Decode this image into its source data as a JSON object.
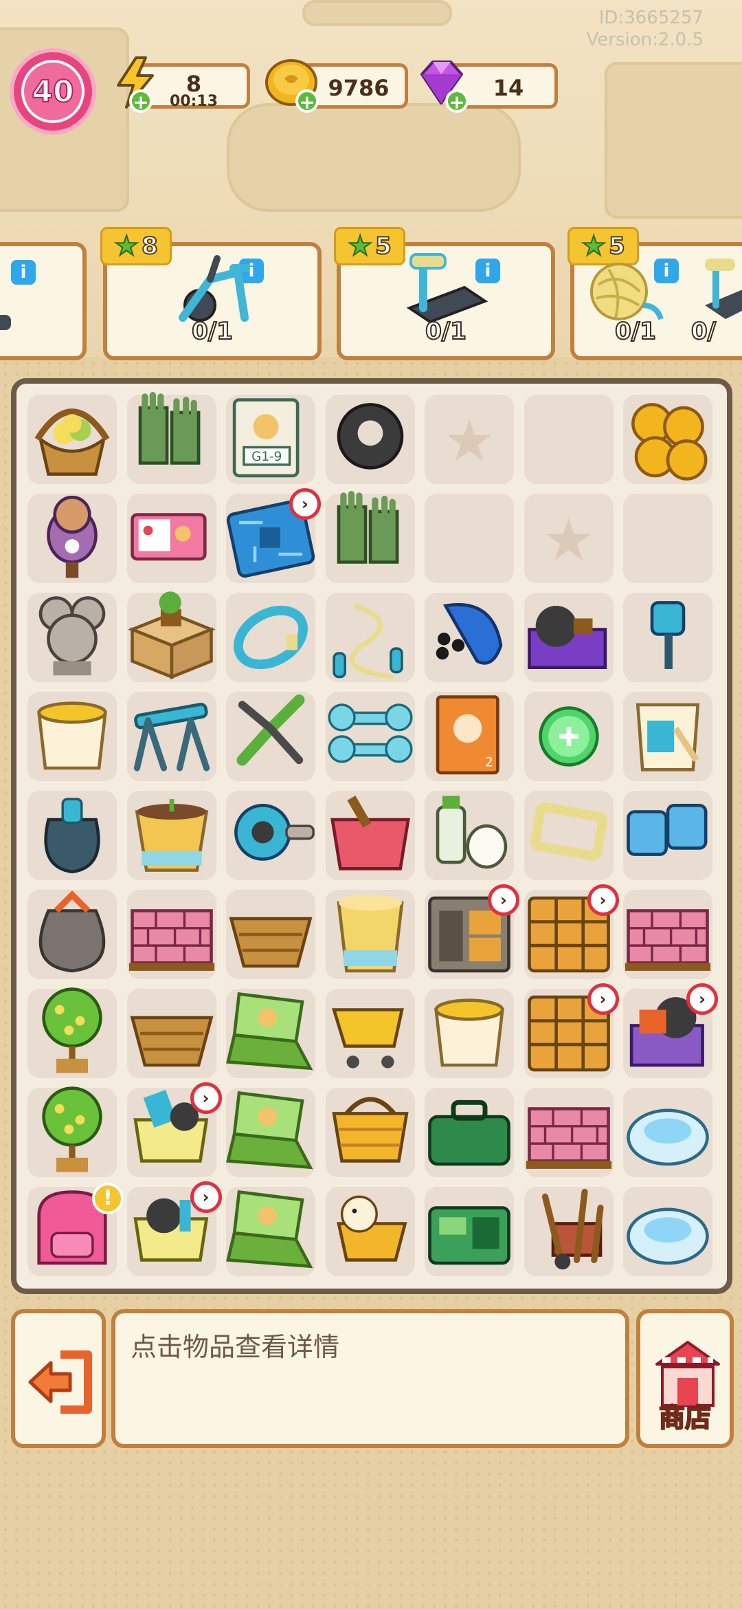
{
  "meta": {
    "id_text": "ID:3665257",
    "version_text": "Version:2.0.5"
  },
  "player": {
    "level": "40"
  },
  "resources": {
    "energy": {
      "value": "8",
      "timer": "00:13"
    },
    "coins": {
      "value": "9786"
    },
    "gems": {
      "value": "14"
    }
  },
  "orders": [
    {
      "stars": "",
      "progress": ""
    },
    {
      "stars": "8",
      "progress": "0/1",
      "item": "exercise-bike"
    },
    {
      "stars": "5",
      "progress": "0/1",
      "item": "treadmill"
    },
    {
      "stars": "5",
      "progress": "0/1",
      "item": "yarn-ball"
    },
    {
      "stars": "",
      "progress": "0/"
    }
  ],
  "inventory": {
    "rows": [
      [
        "flower-basket",
        "green-gloves",
        "book-g1-9",
        "tire",
        "locked-star",
        "empty",
        "gold-coins"
      ],
      [
        "dog-figurine",
        "bento-box",
        "circuit-board",
        "green-gloves",
        "empty",
        "locked-star",
        "empty"
      ],
      [
        "mouse-statue",
        "potted-plant-box",
        "hula-hoop",
        "jump-rope",
        "hair-dryer",
        "purple-crate",
        "paint-roller"
      ],
      [
        "yellow-bucket",
        "pull-up-bar",
        "garden-shears",
        "dumbbells",
        "orange-book",
        "green-button",
        "paint-bucket"
      ],
      [
        "punching-bag",
        "plant-pot",
        "ab-roller",
        "red-pot",
        "cleaning-bottle",
        "yellow-frame",
        "blue-dice"
      ],
      [
        "grey-sack",
        "pink-bricks",
        "wicker-basket",
        "paper-cup",
        "grey-cabinet",
        "yellow-cabinet",
        "pink-bricks"
      ],
      [
        "flower-tree",
        "wicker-basket",
        "green-laptop",
        "shopping-cart",
        "yellow-bucket",
        "yellow-cabinet",
        "junk-pile"
      ],
      [
        "flower-tree",
        "gym-cart",
        "green-laptop",
        "yellow-basket",
        "tackle-box",
        "pink-bricks",
        "robot-vacuum"
      ],
      [
        "pink-backpack",
        "fitness-cart",
        "green-laptop",
        "duck-cart",
        "green-toolbox",
        "tool-set",
        "robot-vacuum"
      ]
    ]
  },
  "bottom": {
    "hint": "点击物品查看详情",
    "shop_label": "商店"
  }
}
